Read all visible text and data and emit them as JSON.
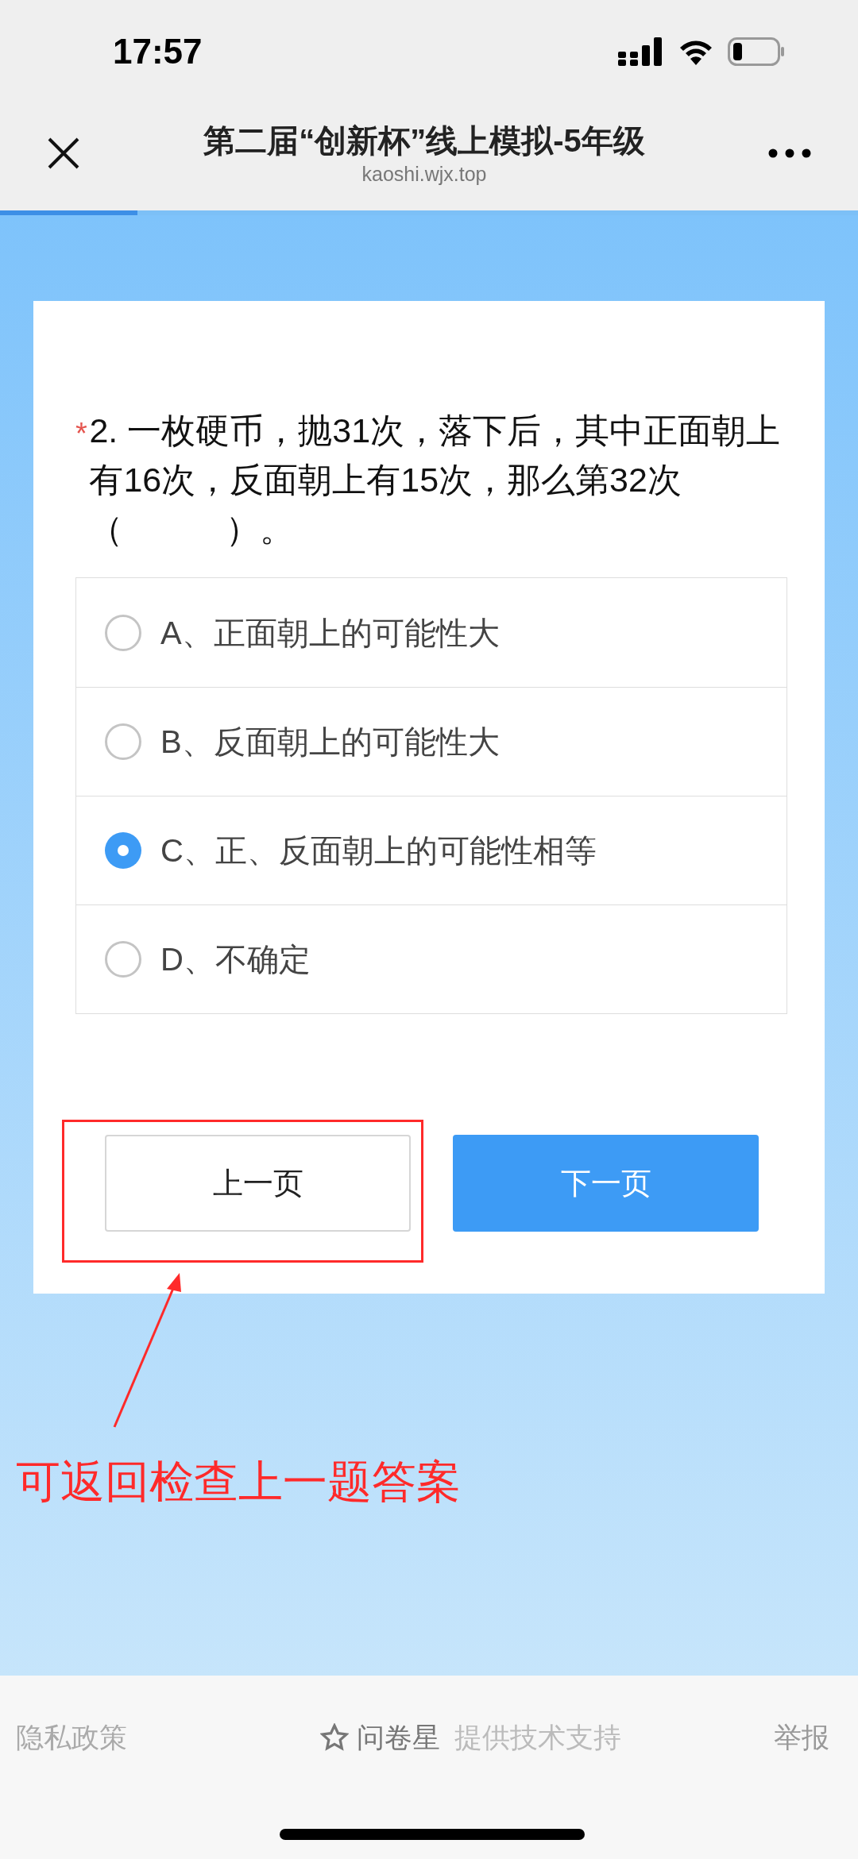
{
  "status_bar": {
    "time": "17:57"
  },
  "nav": {
    "title": "第二届“创新杯”线上模拟-5年级",
    "url": "kaoshi.wjx.top",
    "progress": {
      "level": 0.16
    }
  },
  "question": {
    "required_mark": "*",
    "text": "2. 一枚硬币，抛31次，落下后，其中正面朝上有16次，反面朝上有15次，那么第32次（　　　）。",
    "options": [
      {
        "label": "A、正面朝上的可能性大",
        "selected": false
      },
      {
        "label": "B、反面朝上的可能性大",
        "selected": false
      },
      {
        "label": "C、正、反面朝上的可能性相等",
        "selected": true
      },
      {
        "label": "D、不确定",
        "selected": false
      }
    ]
  },
  "buttons": [
    {
      "label": "上一页",
      "kind": "secondary"
    },
    {
      "label": "下一页",
      "kind": "primary"
    }
  ],
  "annotation": {
    "text": "可返回检查上一题答案"
  },
  "footer": {
    "left": "隐私政策",
    "brand": "问卷星",
    "support": "提供技术支持",
    "right": "举报"
  }
}
